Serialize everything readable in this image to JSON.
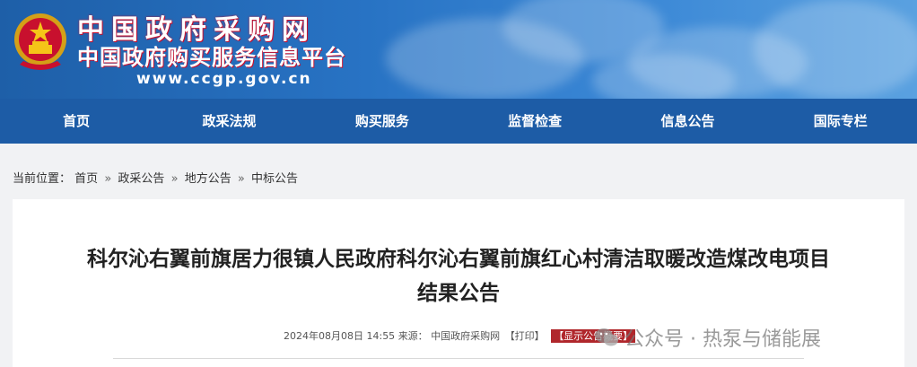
{
  "header": {
    "title": "中国政府采购网",
    "subtitle": "中国政府购买服务信息平台",
    "url": "www.ccgp.gov.cn",
    "emblem_icon": "national-emblem-icon"
  },
  "nav": {
    "items": [
      {
        "label": "首页"
      },
      {
        "label": "政采法规"
      },
      {
        "label": "购买服务"
      },
      {
        "label": "监督检查"
      },
      {
        "label": "信息公告"
      },
      {
        "label": "国际专栏"
      }
    ]
  },
  "breadcrumb": {
    "prefix": "当前位置：",
    "items": [
      "首页",
      "政采公告",
      "地方公告",
      "中标公告"
    ],
    "separator": "»"
  },
  "article": {
    "title_line1": "科尔沁右翼前旗居力很镇人民政府科尔沁右翼前旗红心村清洁取暖改造煤改电项目",
    "title_line2": "结果公告",
    "meta_date": "2024年08月08日 14:55",
    "meta_source_label": "来源：",
    "meta_source": "中国政府采购网",
    "print_label": "【打印】",
    "overview_label": "【显示公告概要】"
  },
  "watermark": {
    "text": "公众号 · 热泵与储能展",
    "icon": "wechat-icon"
  },
  "colors": {
    "banner": "#2873c4",
    "nav": "#1d5ca6",
    "overview_badge": "#b0272c"
  }
}
